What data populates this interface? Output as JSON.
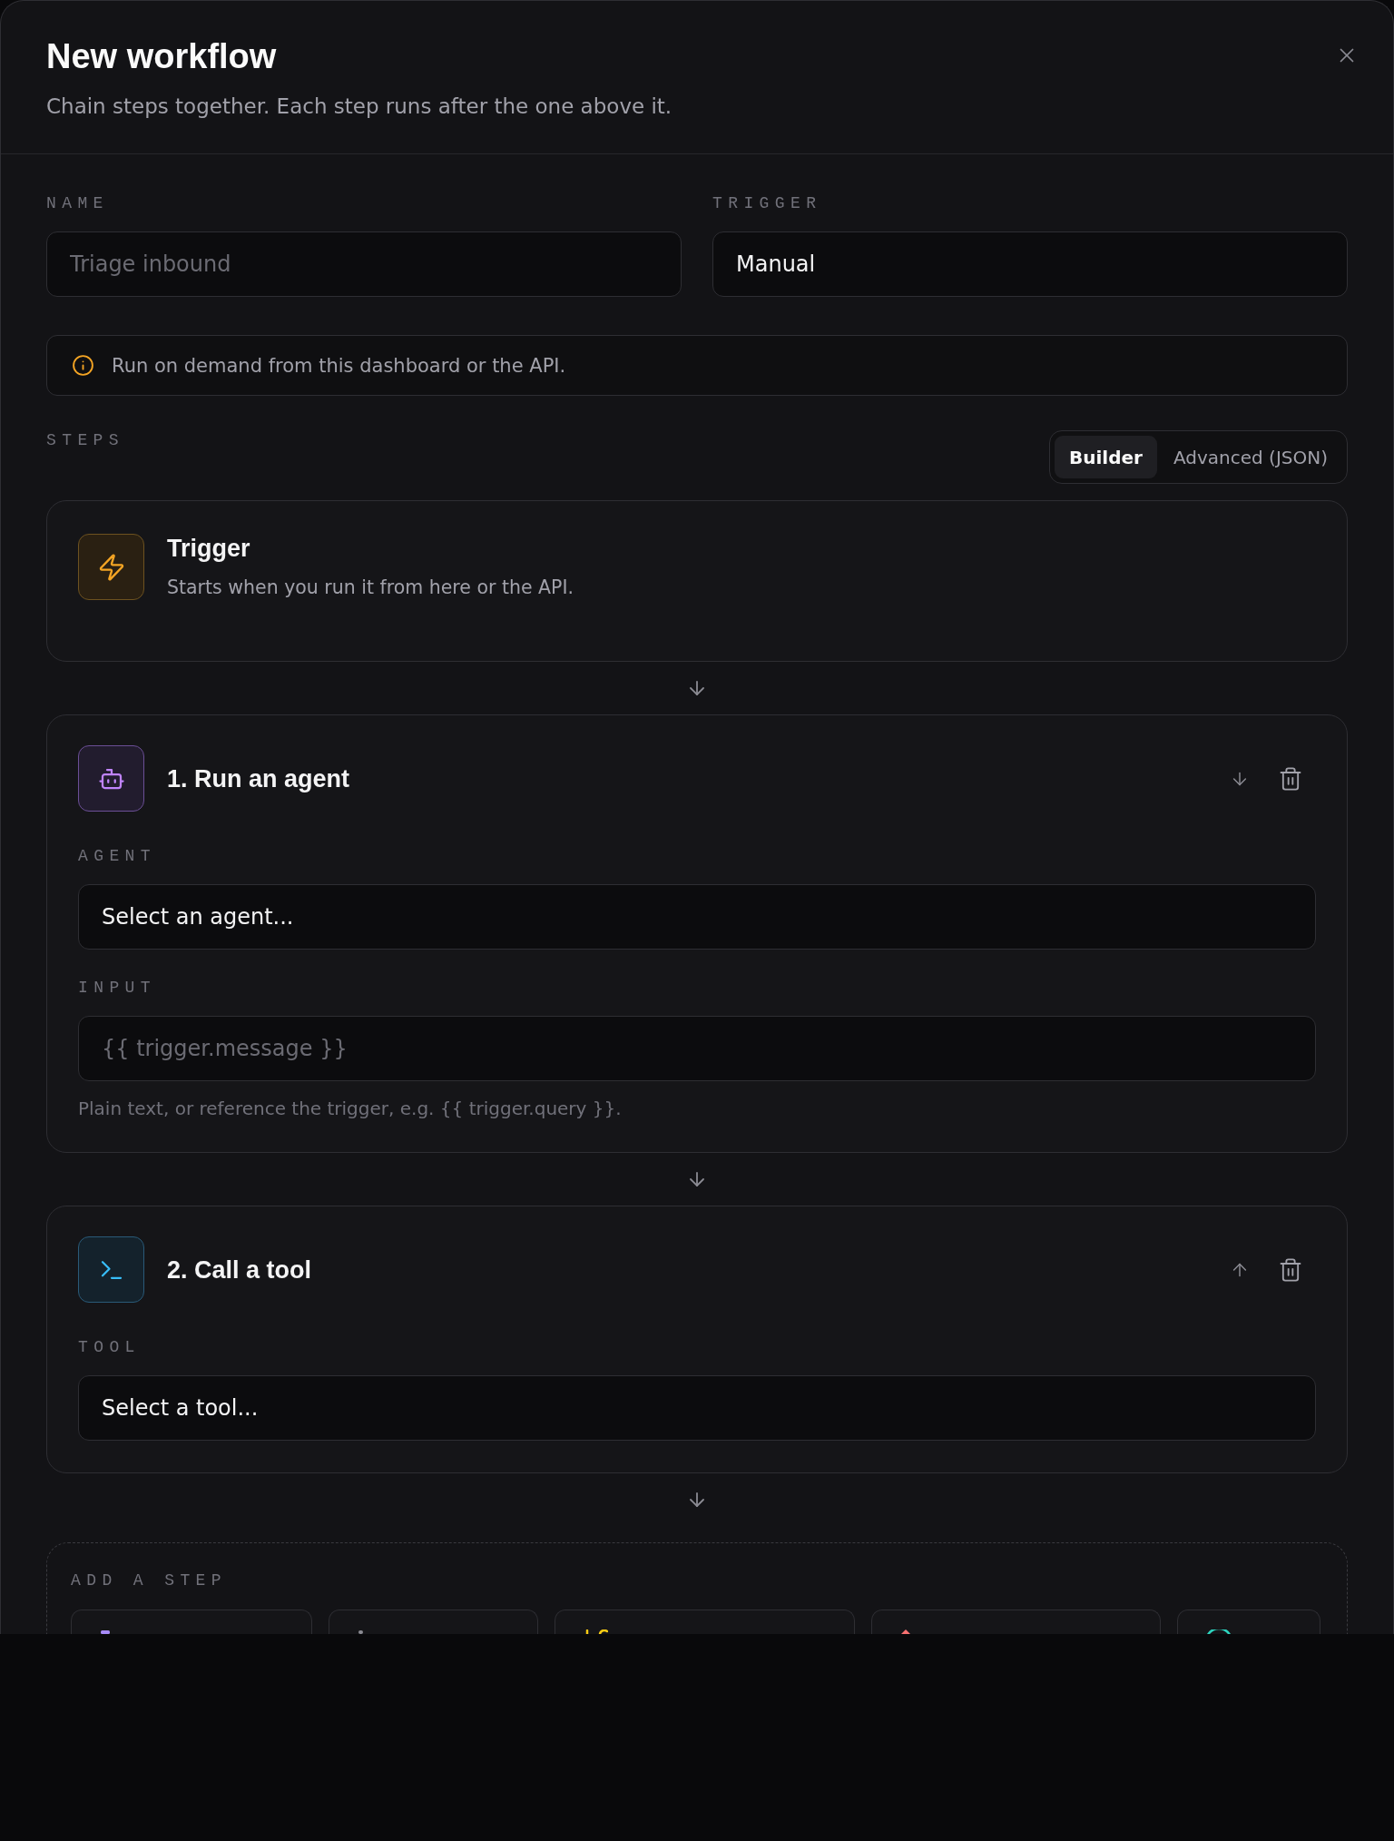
{
  "dialog": {
    "title": "New workflow",
    "subtitle": "Chain steps together. Each step runs after the one above it."
  },
  "fields": [
    {
      "label": "NAME",
      "placeholder": "Triage inbound"
    },
    {
      "label": "TRIGGER",
      "value": "Manual"
    }
  ],
  "info": {
    "text": "Run on demand from this dashboard or the API."
  },
  "steps_header": {
    "label": "STEPS",
    "tabs": [
      {
        "label": "Builder",
        "selected": true
      },
      {
        "label": "Advanced (JSON)",
        "selected": false
      }
    ]
  },
  "trigger_card": {
    "title": "Trigger",
    "description": "Starts when you run it from here or the API."
  },
  "steps": [
    {
      "kind": "agent",
      "title": "1. Run an agent",
      "can_move_up": false,
      "can_move_down": true,
      "fields": [
        {
          "label": "AGENT",
          "value": "Select an agent..."
        },
        {
          "label": "INPUT",
          "placeholder": "{{ trigger.message }}",
          "hint": "Plain text, or reference the trigger, e.g. {{ trigger.query }}."
        }
      ]
    },
    {
      "kind": "tool",
      "title": "2. Call a tool",
      "can_move_up": true,
      "can_move_down": false,
      "fields": [
        {
          "label": "TOOL",
          "value": "Select a tool..."
        }
      ]
    }
  ],
  "add_step": {
    "label": "ADD A STEP",
    "options": [
      {
        "color": "#a78bfa"
      },
      {
        "color": "#8b8b93"
      },
      {
        "color": "#facc15"
      },
      {
        "color": "#f87171"
      },
      {
        "color": "#2dd4bf"
      }
    ]
  }
}
